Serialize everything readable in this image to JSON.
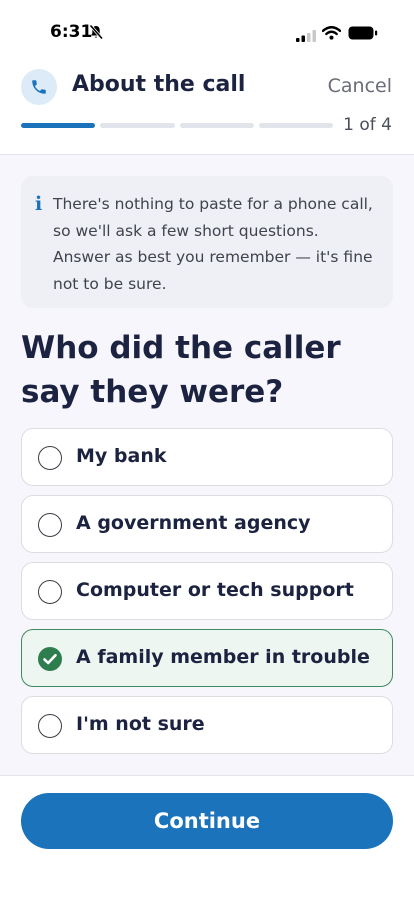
{
  "status_bar": {
    "time": "6:31",
    "icons": [
      "bell-slash-icon",
      "cellular-signal-icon",
      "wifi-icon",
      "battery-icon"
    ]
  },
  "header": {
    "icon": "phone-icon",
    "title": "About the call",
    "cancel_label": "Cancel",
    "step_text": "1 of 4",
    "progress": {
      "current_step": 1,
      "total_steps": 4
    }
  },
  "info_box": {
    "icon": "info-icon",
    "icon_glyph": "i",
    "text": "There's nothing to paste for a phone call, so we'll ask a few short questions. Answer as best you remember — it's fine not to be sure."
  },
  "question": "Who did the caller say they were?",
  "options": [
    {
      "label": "My bank",
      "selected": false
    },
    {
      "label": "A government agency",
      "selected": false
    },
    {
      "label": "Computer or tech support",
      "selected": false
    },
    {
      "label": "A family member in trouble",
      "selected": true
    },
    {
      "label": "I'm not sure",
      "selected": false
    }
  ],
  "footer": {
    "continue_label": "Continue"
  },
  "colors": {
    "accent": "#1a73bb",
    "selected_border": "#3f8a5e",
    "selected_background": "#eef6f1",
    "check_fill": "#2e7d4f",
    "text_primary": "#1c2340",
    "content_background": "#f8f6fd"
  }
}
